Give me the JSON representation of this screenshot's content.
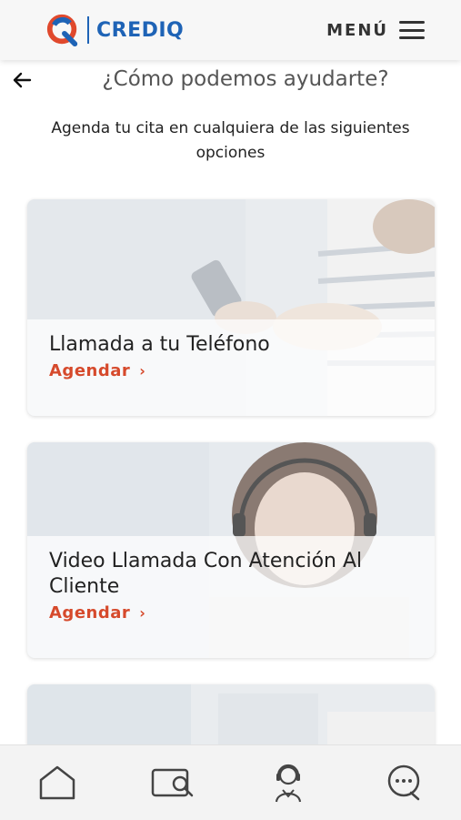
{
  "header": {
    "brand": "CREDIQ",
    "menu_label": "MENÚ"
  },
  "page": {
    "title": "¿Cómo podemos ayudarte?",
    "subtitle": "Agenda tu cita en cualquiera de las siguientes opciones"
  },
  "cards": [
    {
      "title": "Llamada a tu Teléfono",
      "action": "Agendar"
    },
    {
      "title": "Video Llamada Con Atención Al Cliente",
      "action": "Agendar"
    },
    {
      "title": "",
      "action": ""
    }
  ],
  "colors": {
    "brand_blue": "#1e63b6",
    "brand_red": "#e0492d",
    "action_red": "#d64a2c",
    "header_bg": "#f7f7f7",
    "nav_bg": "#f3f3f3"
  },
  "bottom_nav": [
    {
      "icon": "home-icon"
    },
    {
      "icon": "card-search-icon"
    },
    {
      "icon": "agent-headset-icon"
    },
    {
      "icon": "chat-bubble-icon"
    }
  ]
}
